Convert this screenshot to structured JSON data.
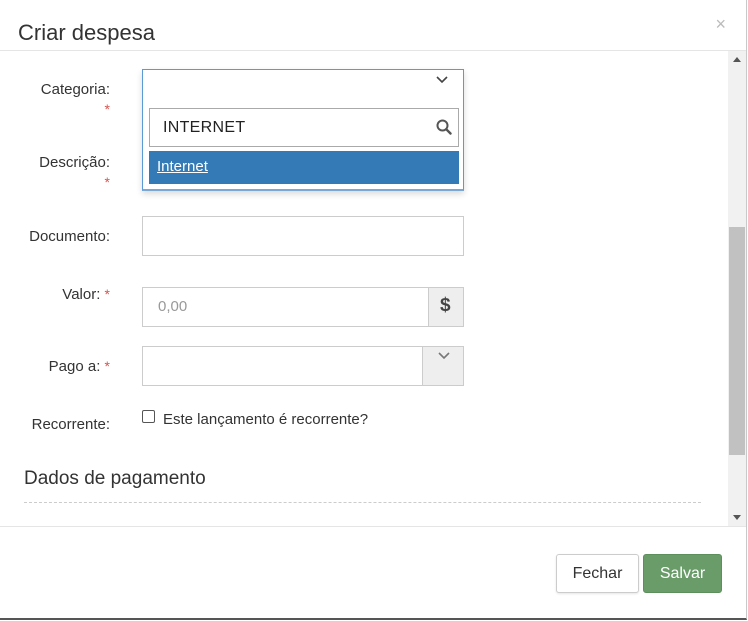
{
  "modal": {
    "title": "Criar despesa",
    "close_glyph": "×"
  },
  "form": {
    "categoria": {
      "label": "Categoria:",
      "required": "*"
    },
    "categoria_dropdown": {
      "search_value": "INTERNET",
      "options": [
        {
          "label": "Internet",
          "highlighted": true
        }
      ]
    },
    "descricao": {
      "label": "Descrição:",
      "required": "*"
    },
    "documento": {
      "label": "Documento:",
      "value": ""
    },
    "valor": {
      "label": "Valor:",
      "required": "*",
      "placeholder": "0,00",
      "addon": "$"
    },
    "pago_a": {
      "label": "Pago a:",
      "required": "*",
      "value": ""
    },
    "recorrente": {
      "label": "Recorrente:",
      "checkbox_label": "Este lançamento é recorrente?",
      "checked": false
    }
  },
  "section": {
    "title": "Dados de pagamento"
  },
  "footer": {
    "close_label": "Fechar",
    "save_label": "Salvar"
  },
  "colors": {
    "primary": "#337ab7",
    "success": "#6a9c6a",
    "required": "#d9534f"
  },
  "icons": {
    "search": "search-icon",
    "chevron": "chevron-down-icon",
    "currency": "dollar-icon"
  }
}
